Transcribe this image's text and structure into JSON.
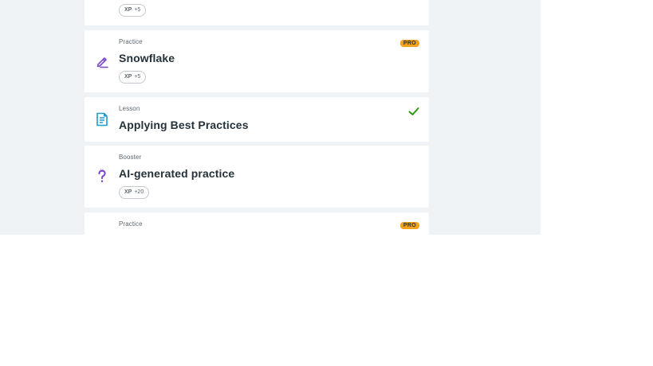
{
  "cards": [
    {
      "xp_label": "XP",
      "xp_value": "+5"
    },
    {
      "type": "Practice",
      "title": "Snowflake",
      "xp_label": "XP",
      "xp_value": "+5",
      "badge": "PRO",
      "icon": "pencil-edit-icon"
    },
    {
      "type": "Lesson",
      "title": "Applying Best Practices",
      "status": "completed",
      "icon": "document-icon"
    },
    {
      "type": "Booster",
      "title": "AI-generated practice",
      "xp_label": "XP",
      "xp_value": "+20",
      "icon": "question-mark-icon"
    },
    {
      "type": "Practice",
      "badge": "PRO"
    }
  ],
  "colors": {
    "page_background": "#eff3f6",
    "card_background": "#ffffff",
    "pro_badge": "#f4a21b",
    "check": "#2d9a17",
    "lesson_icon": "#1e9ad6",
    "practice_icon": "#7a45c6"
  }
}
